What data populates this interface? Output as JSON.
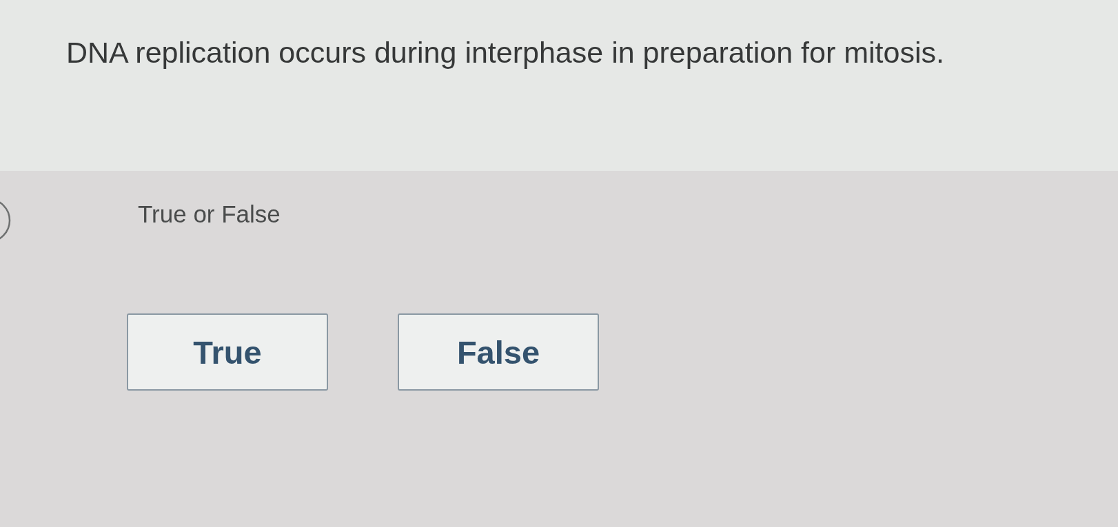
{
  "question": {
    "text": "DNA replication occurs during interphase in preparation for mitosis."
  },
  "answer_area": {
    "instruction": "True or False",
    "options": [
      {
        "label": "True",
        "selected": false
      },
      {
        "label": "False",
        "selected": false
      }
    ]
  }
}
